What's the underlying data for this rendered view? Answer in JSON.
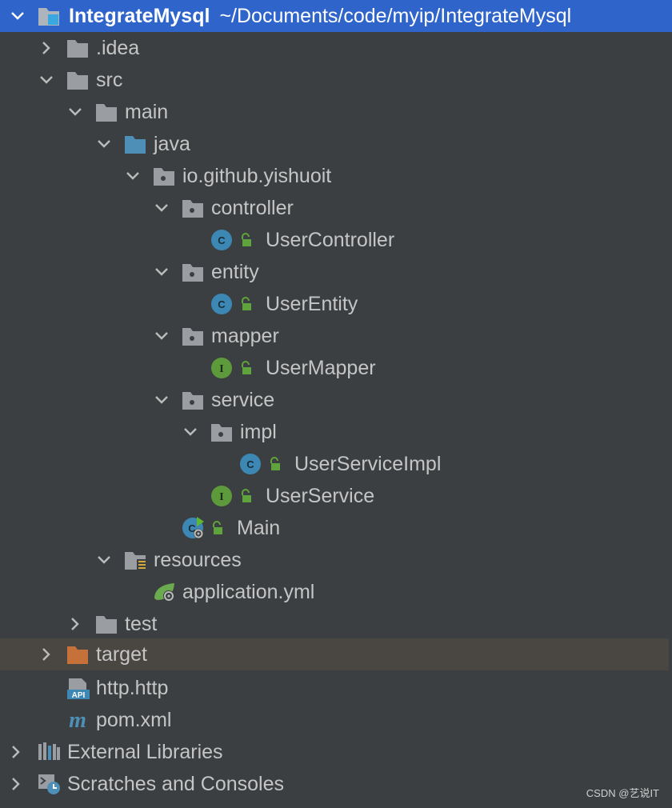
{
  "project": {
    "name": "IntegrateMysql",
    "path": "~/Documents/code/myip/IntegrateMysql"
  },
  "tree": {
    "idea": ".idea",
    "src": "src",
    "main": "main",
    "java": "java",
    "package": "io.github.yishuoit",
    "controller": "controller",
    "user_controller": "UserController",
    "entity": "entity",
    "user_entity": "UserEntity",
    "mapper": "mapper",
    "user_mapper": "UserMapper",
    "service": "service",
    "impl": "impl",
    "user_service_impl": "UserServiceImpl",
    "user_service": "UserService",
    "main_class": "Main",
    "resources": "resources",
    "application_yml": "application.yml",
    "test": "test",
    "target": "target",
    "http_file": "http.http",
    "pom": "pom.xml",
    "external_libraries": "External Libraries",
    "scratches": "Scratches and Consoles"
  },
  "icons": {
    "class_badge": "C",
    "interface_badge": "I",
    "api_badge": "API",
    "maven_badge": "m"
  },
  "colors": {
    "background": "#3c3f41",
    "selection": "#2f65ca",
    "highlight_row": "#4a4641",
    "folder": "#9a9da1",
    "source_folder": "#4e8fb8",
    "excluded_folder": "#c7713a",
    "class_icon": "#3d87b5",
    "interface_icon": "#5c9a3b",
    "lock": "#5fa33c"
  },
  "watermark": "CSDN @艺说IT"
}
